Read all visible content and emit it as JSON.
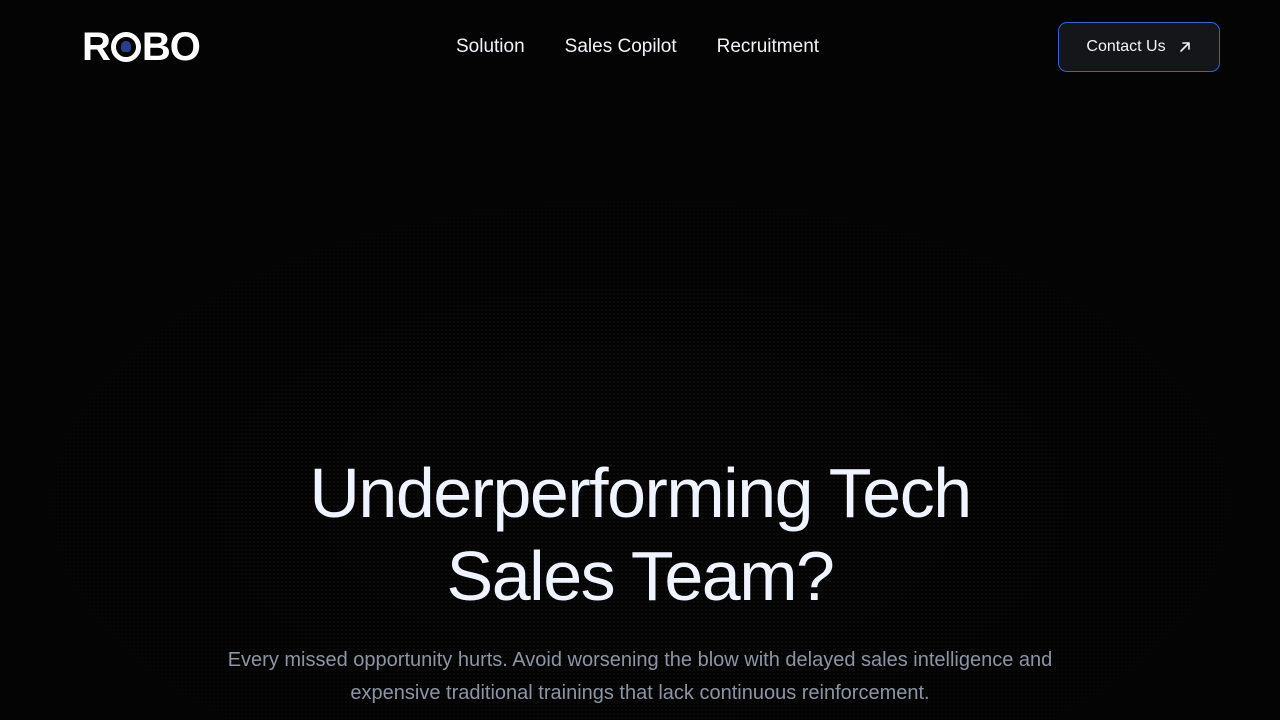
{
  "brand": {
    "logo_text": "ROBO"
  },
  "nav": {
    "items": [
      {
        "label": "Solution"
      },
      {
        "label": "Sales Copilot"
      },
      {
        "label": "Recruitment"
      }
    ]
  },
  "header": {
    "contact_label": "Contact Us",
    "contact_icon": "arrow-up-right-icon"
  },
  "hero": {
    "title_line1": "Underperforming Tech",
    "title_line2": "Sales Team?",
    "subtitle": "Every missed opportunity hurts. Avoid worsening the blow with delayed sales intelligence and expensive traditional trainings that lack continuous reinforcement."
  },
  "colors": {
    "background": "#040405",
    "accent_border": "#2f63d6",
    "heading": "#f0f4ff",
    "muted_text": "#8d94a3"
  }
}
